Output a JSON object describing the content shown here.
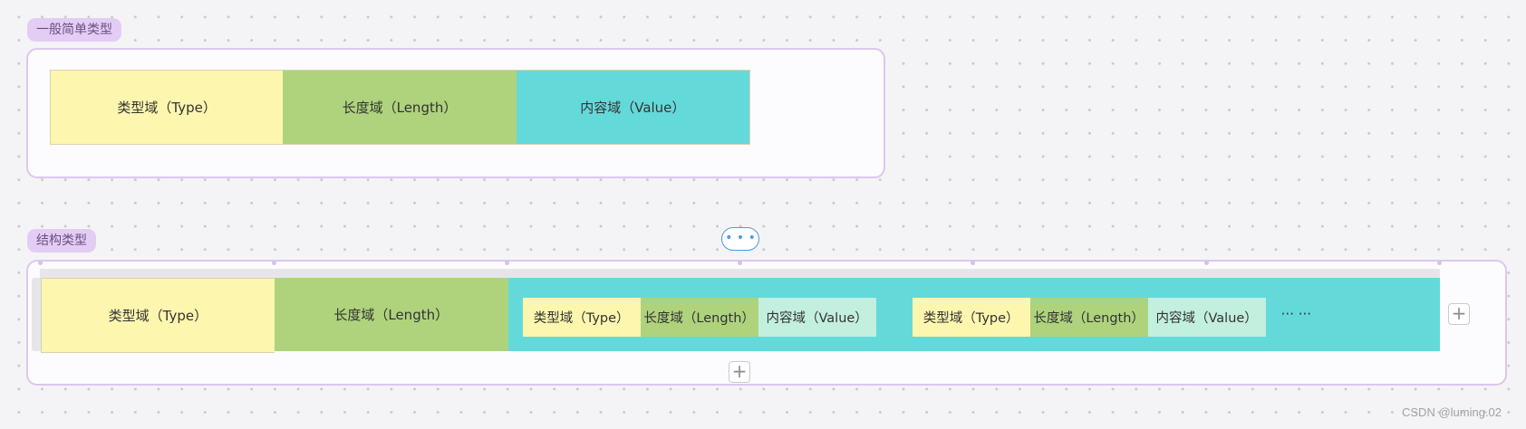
{
  "simple_section": {
    "tag": "一般简单类型",
    "cells": {
      "type": "类型域（Type）",
      "length": "长度域（Length）",
      "value": "内容域（Value）"
    }
  },
  "more_button": {
    "label": "• • •"
  },
  "struct_section": {
    "tag": "结构类型",
    "outer": {
      "type": "类型域（Type）",
      "length": "长度域（Length）"
    },
    "nested": [
      {
        "type": "类型域（Type）",
        "length": "长度域（Length）",
        "value": "内容域（Value）"
      },
      {
        "type": "类型域（Type）",
        "length": "长度域（Length）",
        "value": "内容域（Value）"
      }
    ],
    "ellipsis": "··· ···"
  },
  "buttons": {
    "add_right": "+",
    "add_bottom": "+"
  },
  "colors": {
    "type": "#fdf6ae",
    "length": "#aed37c",
    "value": "#64d9da",
    "nested_value": "#c3efdf",
    "frame_border": "#dcc7ee",
    "tag_bg": "#e3cdf4",
    "accent": "#4a9be5"
  },
  "watermark": "CSDN @luming.02"
}
